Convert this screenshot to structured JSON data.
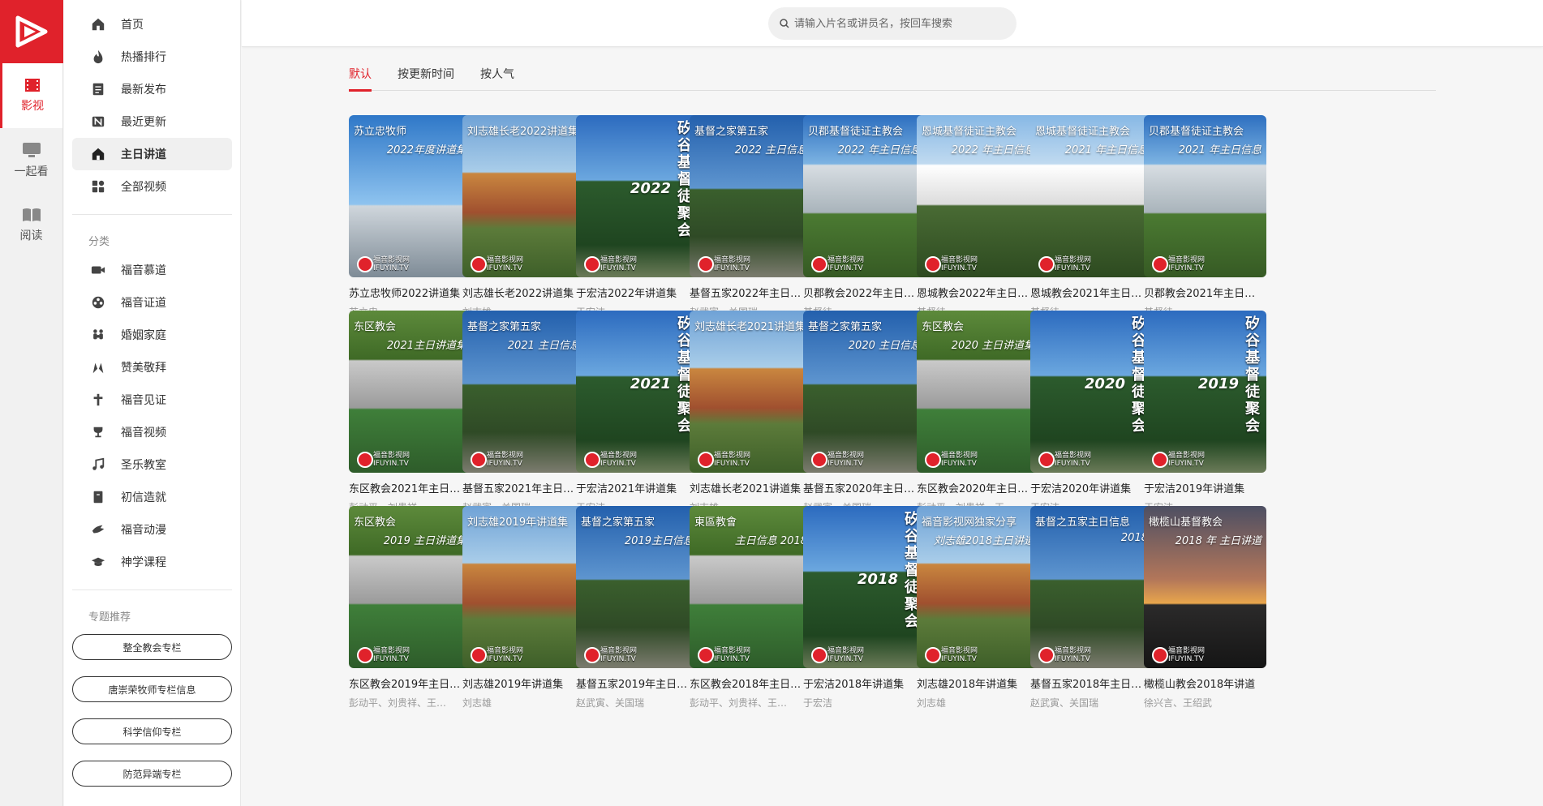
{
  "rail": {
    "items": [
      {
        "label": "影视",
        "icon": "film-icon",
        "active": true
      },
      {
        "label": "一起看",
        "icon": "monitor-icon",
        "active": false
      },
      {
        "label": "阅读",
        "icon": "book-icon",
        "active": false
      }
    ]
  },
  "menu": {
    "main": [
      {
        "label": "首页",
        "icon": "home-icon"
      },
      {
        "label": "热播排行",
        "icon": "flame-icon"
      },
      {
        "label": "最新发布",
        "icon": "document-icon"
      },
      {
        "label": "最近更新",
        "icon": "new-badge-icon"
      },
      {
        "label": "主日讲道",
        "icon": "church-icon",
        "active": true
      },
      {
        "label": "全部视频",
        "icon": "grid-icon"
      }
    ],
    "category_heading": "分类",
    "categories": [
      {
        "label": "福音慕道",
        "icon": "video-camera-icon"
      },
      {
        "label": "福音证道",
        "icon": "film-reel-icon"
      },
      {
        "label": "婚姻家庭",
        "icon": "family-icon"
      },
      {
        "label": "赞美敬拜",
        "icon": "praise-hands-icon"
      },
      {
        "label": "福音见证",
        "icon": "cross-icon"
      },
      {
        "label": "福音视频",
        "icon": "trophy-icon"
      },
      {
        "label": "圣乐教室",
        "icon": "music-note-icon"
      },
      {
        "label": "初信造就",
        "icon": "bible-icon"
      },
      {
        "label": "福音动漫",
        "icon": "dove-icon"
      },
      {
        "label": "神学课程",
        "icon": "graduation-cap-icon"
      }
    ],
    "topics_heading": "专题推荐",
    "topics": [
      "整全教会专栏",
      "唐崇荣牧师专栏信息",
      "科学信仰专栏",
      "防范异端专栏"
    ]
  },
  "search": {
    "placeholder": "请输入片名或讲员名，按回车搜索"
  },
  "tabs": [
    {
      "label": "默认",
      "active": true
    },
    {
      "label": "按更新时间",
      "active": false
    },
    {
      "label": "按人气",
      "active": false
    }
  ],
  "cards": [
    {
      "title": "苏立忠牧师2022讲道集",
      "speaker": "苏立忠",
      "art": "sky",
      "line1": "苏立忠牧师",
      "line2": "2022年度讲道集"
    },
    {
      "title": "刘志雄长老2022讲道集",
      "speaker": "刘志雄",
      "art": "house",
      "line1": "刘志雄长老2022讲道集",
      "line2": ""
    },
    {
      "title": "于宏洁2022年讲道集",
      "speaker": "于宏洁",
      "art": "tree",
      "vert": "矽谷基督徒聚会",
      "line2": "2022"
    },
    {
      "title": "基督五家2022年主日…",
      "speaker": "赵武寅、关国瑞",
      "art": "cross",
      "line1": "基督之家第五家",
      "line2": "2022 主日信息"
    },
    {
      "title": "贝郡教会2022年主日…",
      "speaker": "基督徒",
      "art": "chapel",
      "line1": "贝郡基督徒证主教会",
      "line2": "2022 年主日信息"
    },
    {
      "title": "恩城教会2022年主日…",
      "speaker": "基督徒",
      "art": "sign",
      "line1": "恩城基督徒证主教会",
      "line2": "2022 年主日信息"
    },
    {
      "title": "恩城教会2021年主日…",
      "speaker": "基督徒",
      "art": "sign",
      "line1": "恩城基督徒证主教会",
      "line2": "2021 年主日信息"
    },
    {
      "title": "贝郡教会2021年主日…",
      "speaker": "基督徒",
      "art": "chapel",
      "line1": "贝郡基督徒证主教会",
      "line2": "2021 年主日信息"
    },
    {
      "title": "东区教会2021年主日…",
      "speaker": "彭动平、刘贵祥",
      "art": "church",
      "line1": "东区教会",
      "line2": "2021主日讲道集"
    },
    {
      "title": "基督五家2021年主日…",
      "speaker": "赵武寅、关国瑞",
      "art": "cross",
      "line1": "基督之家第五家",
      "line2": "2021 主日信息"
    },
    {
      "title": "于宏洁2021年讲道集",
      "speaker": "于宏洁",
      "art": "tree",
      "vert": "矽谷基督徒聚会",
      "line2": "2021"
    },
    {
      "title": "刘志雄长老2021讲道集",
      "speaker": "刘志雄",
      "art": "house",
      "line1": "刘志雄长老2021讲道集",
      "line2": ""
    },
    {
      "title": "基督五家2020年主日…",
      "speaker": "赵武寅、关国瑞",
      "art": "cross",
      "line1": "基督之家第五家",
      "line2": "2020 主日信息"
    },
    {
      "title": "东区教会2020年主日…",
      "speaker": "彭动平、刘贵祥、王…",
      "art": "church",
      "line1": "东区教会",
      "line2": "2020 主日讲道集"
    },
    {
      "title": "于宏洁2020年讲道集",
      "speaker": "于宏洁",
      "art": "tree",
      "vert": "矽谷基督徒聚会",
      "line2": "2020"
    },
    {
      "title": "于宏洁2019年讲道集",
      "speaker": "于宏洁",
      "art": "tree",
      "vert": "矽谷基督徒聚会",
      "line2": "2019"
    },
    {
      "title": "东区教会2019年主日…",
      "speaker": "彭动平、刘贵祥、王…",
      "art": "church",
      "line1": "东区教会",
      "line2": "2019 主日讲道集"
    },
    {
      "title": "刘志雄2019年讲道集",
      "speaker": "刘志雄",
      "art": "house",
      "line1": "刘志雄2019年讲道集",
      "line2": ""
    },
    {
      "title": "基督五家2019年主日…",
      "speaker": "赵武寅、关国瑞",
      "art": "cross",
      "line1": "基督之家第五家",
      "line2": "2019主日信息"
    },
    {
      "title": "东区教会2018年主日…",
      "speaker": "彭动平、刘贵祥、王…",
      "art": "church",
      "line1": "東區教會",
      "line2": "主日信息 2018"
    },
    {
      "title": "于宏洁2018年讲道集",
      "speaker": "于宏洁",
      "art": "tree",
      "vert": "矽谷基督徒聚会",
      "line2": "2018"
    },
    {
      "title": "刘志雄2018年讲道集",
      "speaker": "刘志雄",
      "art": "house",
      "line1": "福音影视网独家分享",
      "line2": "刘志雄2018主日讲道"
    },
    {
      "title": "基督五家2018年主日…",
      "speaker": "赵武寅、关国瑞",
      "art": "cross",
      "line1": "基督之五家主日信息",
      "line2": "2018"
    },
    {
      "title": "橄榄山教会2018年讲道",
      "speaker": "徐兴言、王绍武",
      "art": "sunset",
      "line1": "橄榄山基督教会",
      "line2": "2018 年 主日讲道"
    }
  ],
  "watermark": {
    "line1": "福音影视网",
    "line2": "IFUYIN.TV"
  },
  "colors": {
    "accent": "#e0222b"
  }
}
